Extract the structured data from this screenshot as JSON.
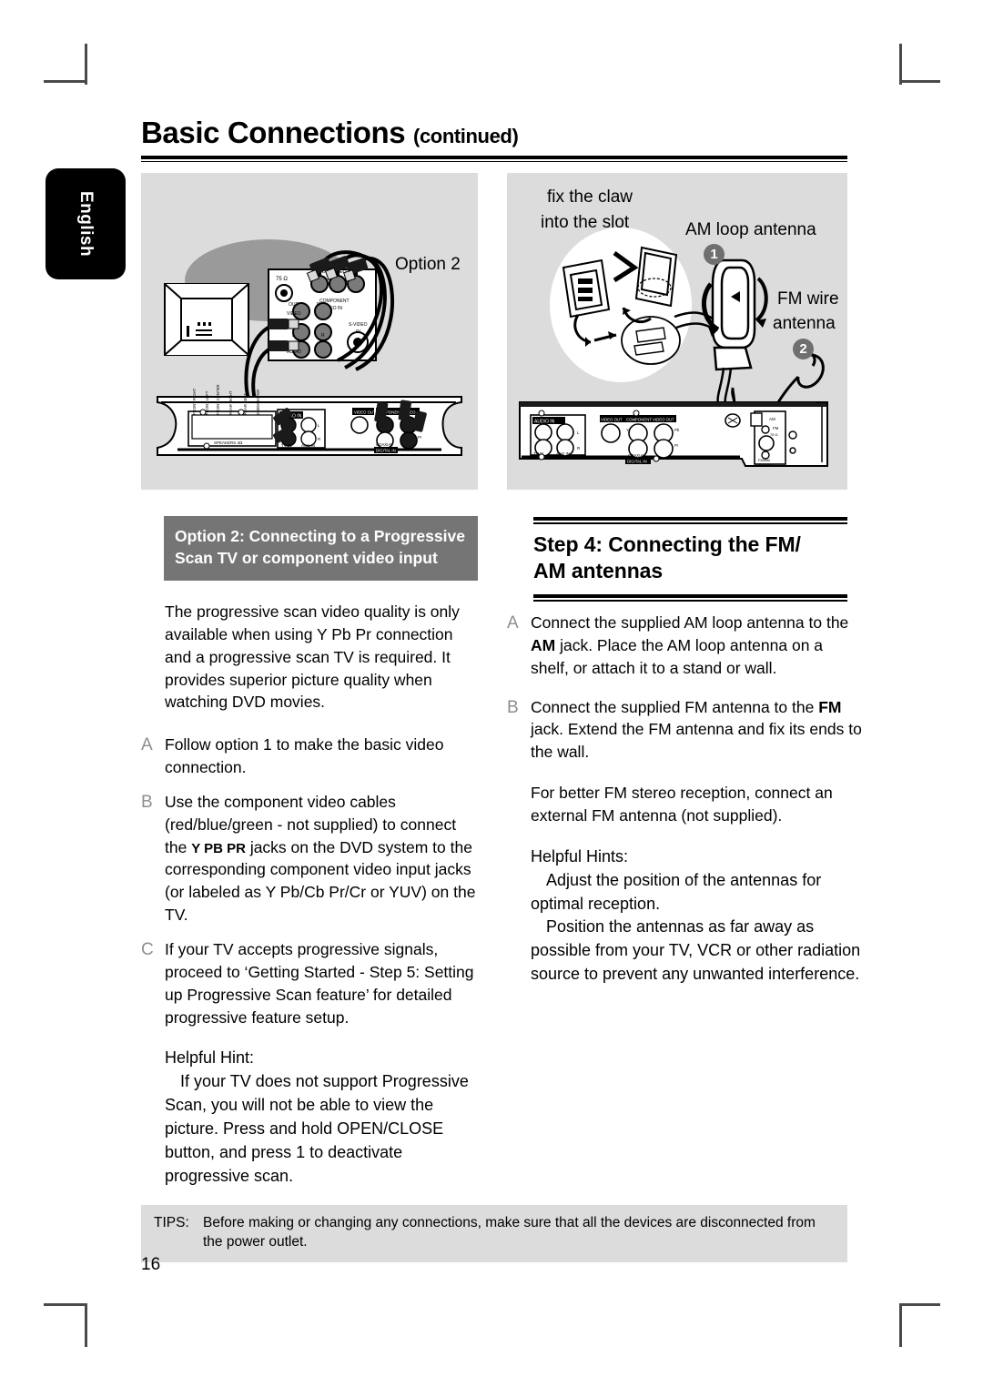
{
  "document": {
    "language_tab": "English",
    "title_main": "Basic Connections",
    "title_continued": "(continued)",
    "page_number": "16"
  },
  "figures": {
    "left": {
      "name": "option-2-component-video-connection-diagram",
      "labels": {
        "option": "Option 2",
        "tv_jack_impedance": "75 Ω",
        "component_video_in": "COMPONENT VIDEO IN",
        "s_video_in": "S-VIDEO IN",
        "video": "VIDEO",
        "audio": "AUDIO",
        "out": "OUT",
        "left_ch": "L",
        "right_ch": "R",
        "speakers_panel": "SPEAKERS 4Ω",
        "front_right": "FRONT RIGHT",
        "front_left": "FRONT LEFT",
        "front_center": "FRONT CENTER",
        "rear_right": "REAR RIGHT",
        "rear_left": "REAR LEFT",
        "subwoofer": "SUBWOOFER",
        "audio_in": "AUDIO IN",
        "tv_in": "TV IN",
        "aux_in": "AUX IN",
        "video_out": "VIDEO OUT",
        "component_video_out": "COMPONENT VIDEO OUT",
        "coaxial": "COAXIAL",
        "digital_in": "DIGITAL IN",
        "y": "Y",
        "pb": "Pb",
        "pr": "Pr"
      }
    },
    "right": {
      "name": "fm-am-antenna-connection-diagram",
      "labels": {
        "claw_line1": "fix the claw",
        "claw_line2": "into the slot",
        "am_loop": "AM loop antenna",
        "am_callout": "1",
        "fm_wire_line1": "FM wire",
        "fm_wire_line2": "antenna",
        "fm_callout": "2",
        "audio_in": "AUDIO IN",
        "tv_in": "TV IN",
        "aux_in": "AUX IN",
        "left_ch": "L",
        "right_ch": "R",
        "video_out": "VIDEO OUT",
        "component_video_out": "COMPONENT VIDEO OUT",
        "coaxial": "COAXIAL",
        "digital_in": "DIGITAL IN",
        "y": "Y",
        "pb": "Pb",
        "pr": "Pr",
        "am": "AM",
        "fm_75": "FM 75 Ω",
        "fm_am_antenna_line1": "FM/AM",
        "fm_am_antenna_line2": "ANTENNA"
      }
    }
  },
  "left_column": {
    "heading": "Option 2: Connecting to a Progressive Scan TV or component video input",
    "intro": "The progressive scan video quality is only available when using Y Pb Pr connection and a progressive scan TV is required. It provides superior picture quality when watching DVD movies.",
    "items": [
      {
        "letter": "A",
        "text": "Follow option 1 to make the basic video connection."
      },
      {
        "letter": "B",
        "text_before": "Use the component video cables (red/blue/green - not supplied) to connect the ",
        "emphasis": "Y PB PR",
        "text_after": " jacks on the DVD system to the corresponding component video input jacks (or labeled as Y Pb/Cb Pr/Cr or YUV) on the TV."
      },
      {
        "letter": "C",
        "text": "If your TV accepts progressive signals, proceed to ‘Getting Started - Step 5: Setting up Progressive Scan feature’ for detailed progressive feature setup."
      }
    ],
    "hint": {
      "title": "Helpful Hint:",
      "items": [
        "If your TV does not support Progressive Scan, you will not be able to view the picture. Press and hold OPEN/CLOSE button, and press  1  to deactivate progressive scan."
      ]
    }
  },
  "right_column": {
    "heading_line1": "Step 4:  Connecting the FM/",
    "heading_line2": "AM antennas",
    "items": [
      {
        "letter": "A",
        "text_before": "Connect the supplied AM loop antenna to the ",
        "emphasis": "AM",
        "text_after": " jack.  Place the AM loop antenna on a shelf, or attach it to a stand or wall."
      },
      {
        "letter": "B",
        "text_before": "Connect the supplied FM antenna to the ",
        "emphasis": "FM",
        "text_after": " jack.  Extend the FM antenna and fix its ends to the wall."
      }
    ],
    "note": "For better FM stereo reception, connect an external FM antenna (not supplied).",
    "hint": {
      "title": "Helpful Hints:",
      "items": [
        "Adjust the position of the antennas for optimal reception.",
        "Position the antennas as far away as possible from your TV, VCR or other radiation source to prevent any unwanted interference."
      ]
    }
  },
  "footer": {
    "tips_label": "TIPS:",
    "tips_text": "Before making or changing any connections, make sure that all the devices are disconnected from the power outlet."
  },
  "colors": {
    "panel_gray": "#dcdcdc",
    "heading_gray": "#757575",
    "letter_gray": "#8e8e8e",
    "black": "#000000",
    "white": "#ffffff"
  }
}
